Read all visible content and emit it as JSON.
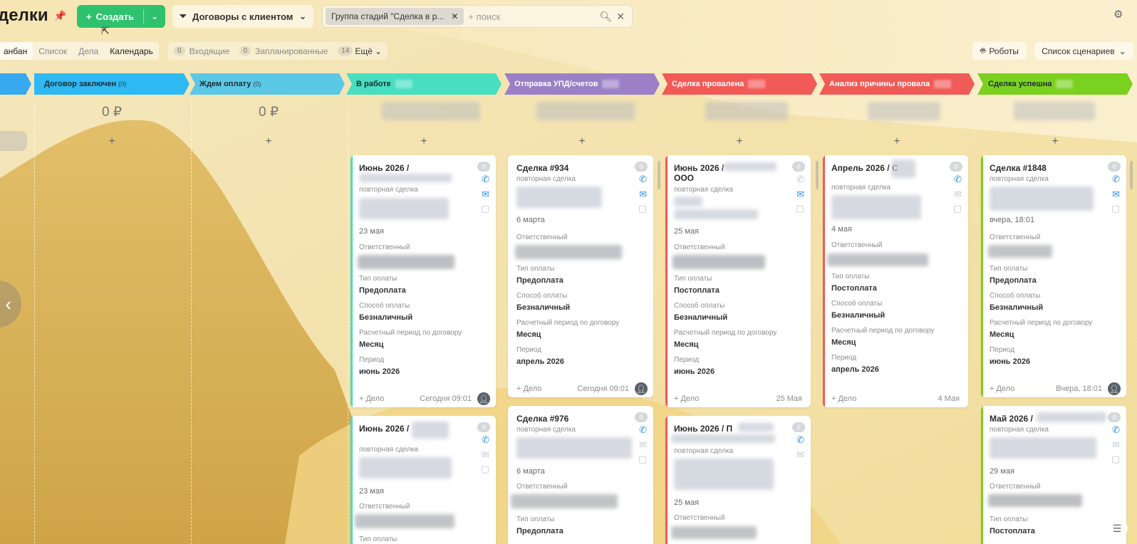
{
  "header": {
    "title": "делки",
    "create_label": "Создать",
    "contracts_label": "Договоры с клиентом",
    "filter_chip": "Группа стадий \"Сделка в р...",
    "search_placeholder": "+ поиск"
  },
  "view_tabs": [
    "анбан",
    "Список",
    "Дела",
    "Календарь"
  ],
  "counters": [
    {
      "count": "0",
      "label": "Входящие"
    },
    {
      "count": "0",
      "label": "Запланированные"
    },
    {
      "count": "14",
      "label": "Ещё"
    }
  ],
  "toolbar_right": {
    "robots": "Роботы",
    "scenarios": "Список сценариев"
  },
  "stages": [
    {
      "name": "Договор заключен",
      "count": "(0)",
      "color": "#2fb9f2",
      "sum": "0 ₽"
    },
    {
      "name": "Ждем оплату",
      "count": "(0)",
      "color": "#5bc8e6",
      "sum": "0 ₽"
    },
    {
      "name": "В работе",
      "count": "",
      "color": "#47dfc0",
      "sum": ""
    },
    {
      "name": "Отправка УПД/счетов",
      "count": "",
      "color": "#9b80c7",
      "sum": ""
    },
    {
      "name": "Сделка провалена",
      "count": "",
      "color": "#f25a57",
      "sum": ""
    },
    {
      "name": "Анализ причины провала",
      "count": "",
      "color": "#f05b58",
      "sum": ""
    },
    {
      "name": "Сделка успешна",
      "count": "",
      "color": "#7bd11f",
      "sum": ""
    }
  ],
  "labels": {
    "repeat_deal": "повторная сделка",
    "responsible": "Ответственный",
    "pay_type": "Тип оплаты",
    "pay_method": "Способ оплаты",
    "period_contract": "Расчетный период по договору",
    "period": "Период",
    "add_task": "+ Дело",
    "badge": "0"
  },
  "cards": {
    "c1": {
      "title": "Июнь 2026 /",
      "date": "23 мая",
      "pay_type": "Предоплата",
      "pay_method": "Безналичный",
      "period_contract": "Месяц",
      "period": "июнь 2026",
      "foot": "Сегодня 09:01"
    },
    "c2": {
      "title": "Сделка #934",
      "date": "6 марта",
      "pay_type": "Предоплата",
      "pay_method": "Безналичный",
      "period_contract": "Месяц",
      "period": "апрель 2026",
      "foot": "Сегодня 09:01"
    },
    "c3": {
      "title": "Июнь 2026 /",
      "title2": "ООО",
      "date": "25 мая",
      "pay_type": "Постоплата",
      "pay_method": "Безналичный",
      "period_contract": "Месяц",
      "period": "июнь 2026",
      "foot": "25 Мая"
    },
    "c4": {
      "title": "Апрель 2026 / С",
      "date": "4 мая",
      "pay_type": "Постоплата",
      "pay_method": "Безналичный",
      "period_contract": "Месяц",
      "period": "апрель 2026",
      "foot": "4 Мая"
    },
    "c5": {
      "title": "Сделка #1848",
      "date": "вчера, 18:01",
      "pay_type": "Предоплата",
      "pay_method": "Безналичный",
      "period_contract": "Месяц",
      "period": "июнь 2026",
      "foot": "Вчера, 18:01"
    },
    "c6": {
      "title": "Июнь 2026 /",
      "date": "23 мая"
    },
    "c7": {
      "title": "Сделка #976",
      "date": "6 марта",
      "pay_type": "Предоплата"
    },
    "c8": {
      "title": "Июнь 2026 / П",
      "date": "25 мая"
    },
    "c9": {
      "title": "Май 2026 /",
      "date": "29 мая",
      "pay_type": "Постоплата"
    }
  },
  "colors": {
    "accent_green": "#2fc26e",
    "link_blue": "#2b8fe0"
  }
}
